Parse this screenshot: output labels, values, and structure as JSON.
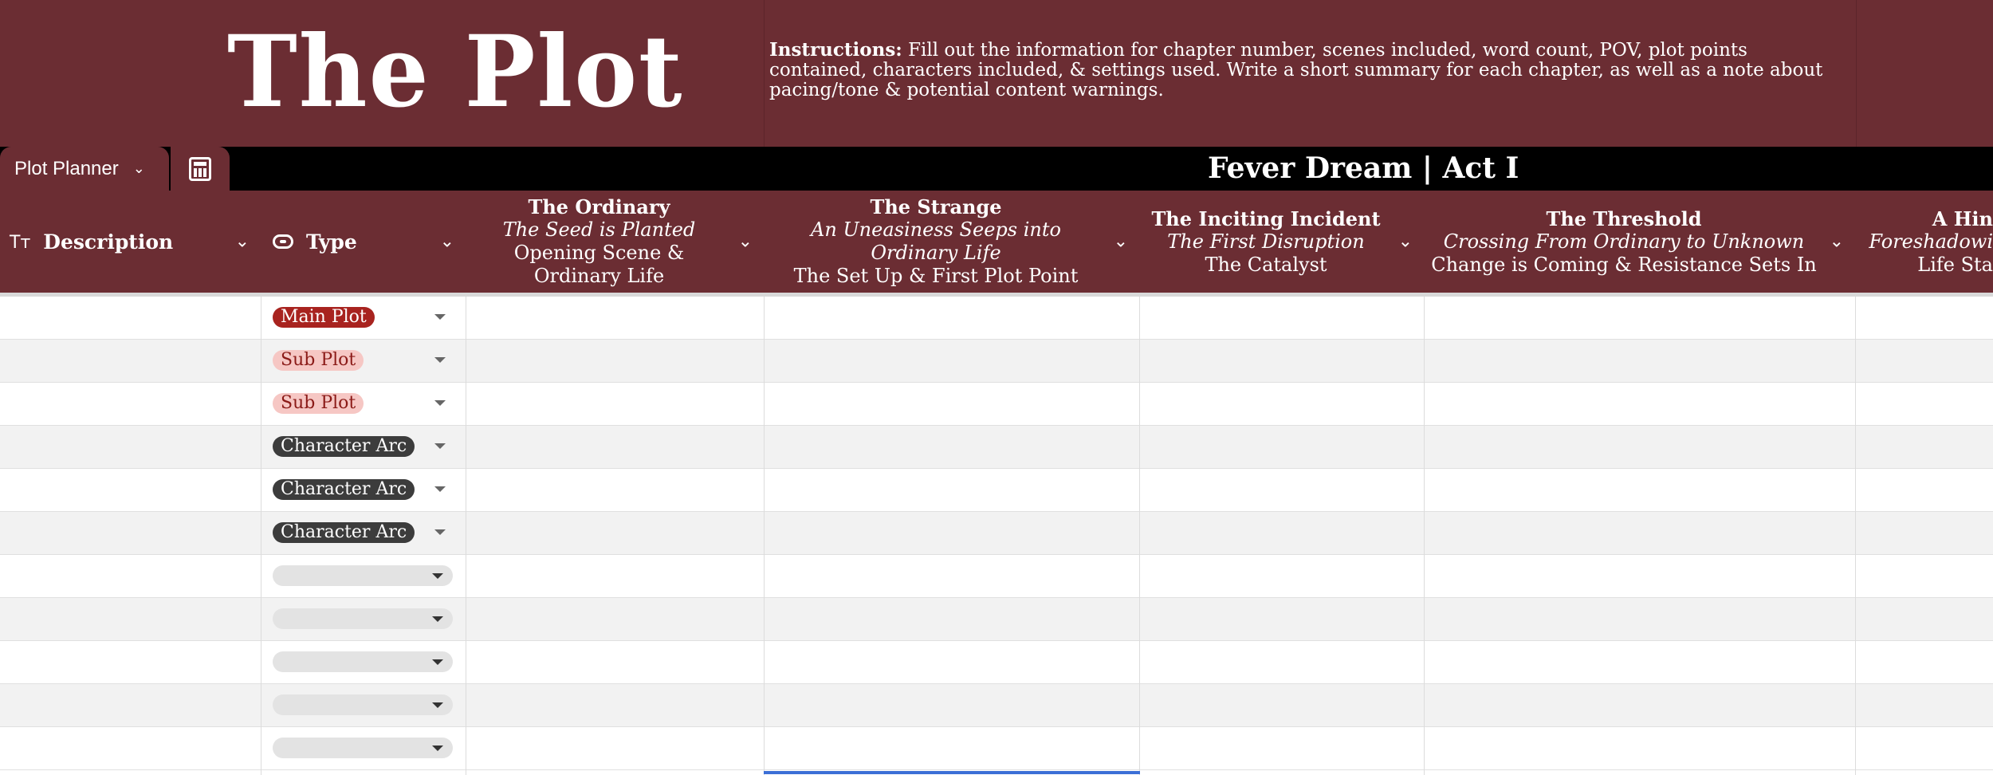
{
  "banner": {
    "title": "The Plot",
    "instructions_label": "Instructions:",
    "instructions_text": " Fill out the information for chapter number, scenes included, word count, POV, plot points contained, characters included, & settings used. Write a short summary for each chapter, as well as a note about pacing/tone & potential content warnings."
  },
  "tabs": {
    "plot_planner": "Plot Planner",
    "calc_icon": "calculator-icon"
  },
  "sheet_title": "Fever Dream | Act I",
  "columns": {
    "description": "Description",
    "type": "Type",
    "ordinary": {
      "title": "The Ordinary",
      "subtitle": "The Seed is Planted",
      "note": "Opening Scene & Ordinary Life"
    },
    "strange": {
      "title": "The Strange",
      "subtitle": "An Uneasiness Seeps into Ordinary Life",
      "note": "The Set Up & First Plot Point"
    },
    "inciting": {
      "title": "The Inciting Incident",
      "subtitle": "The First Disruption",
      "note": "The Catalyst"
    },
    "threshold": {
      "title": "The Threshold",
      "subtitle": "Crossing From Ordinary to Unknown",
      "note": "Change is Coming & Resistance Sets In"
    },
    "hint": {
      "title": "A Hin",
      "subtitle": "Foreshadowi",
      "note": "Life Sta"
    }
  },
  "rows": [
    {
      "type": "Main Plot"
    },
    {
      "type": "Sub Plot"
    },
    {
      "type": "Sub Plot"
    },
    {
      "type": "Character Arc"
    },
    {
      "type": "Character Arc"
    },
    {
      "type": "Character Arc"
    },
    {
      "type": ""
    },
    {
      "type": ""
    },
    {
      "type": ""
    },
    {
      "type": ""
    },
    {
      "type": ""
    }
  ],
  "colors": {
    "header_bg": "#6b2d33",
    "main_plot": "#a8231f",
    "sub_plot": "#f6c7c4",
    "character_arc": "#3c3c3c"
  }
}
